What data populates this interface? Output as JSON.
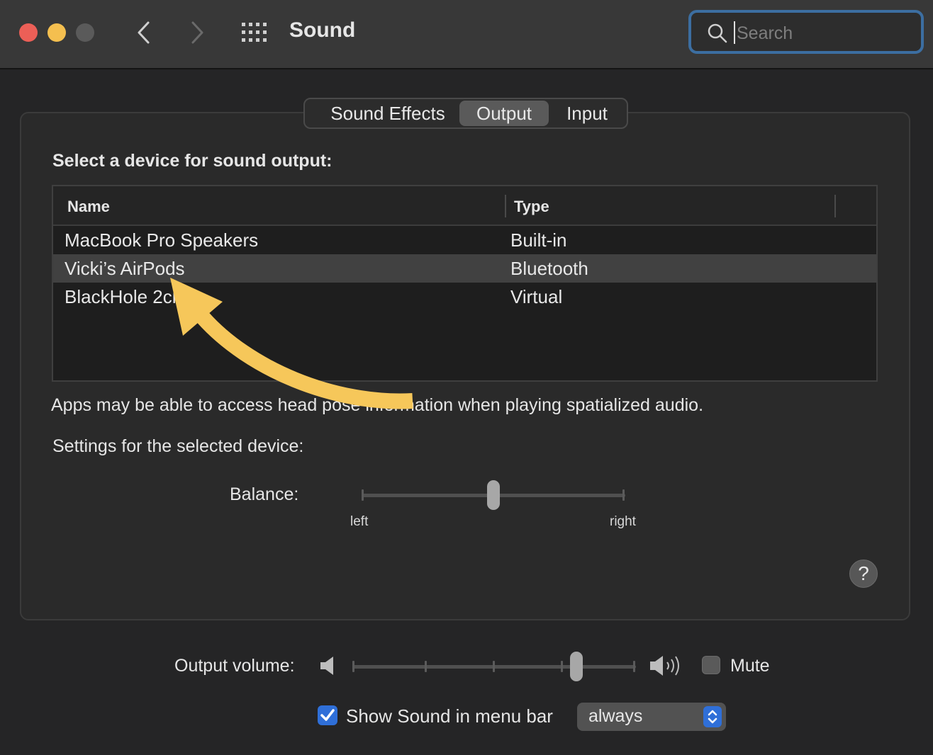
{
  "window": {
    "title": "Sound",
    "search": {
      "placeholder": "Search",
      "value": ""
    }
  },
  "tabs": [
    {
      "label": "Sound Effects",
      "selected": false
    },
    {
      "label": "Output",
      "selected": true
    },
    {
      "label": "Input",
      "selected": false
    }
  ],
  "output": {
    "heading": "Select a device for sound output:",
    "columns": [
      "Name",
      "Type"
    ],
    "devices": [
      {
        "name": "MacBook Pro Speakers",
        "type": "Built-in",
        "selected": false
      },
      {
        "name": "Vicki’s AirPods",
        "type": "Bluetooth",
        "selected": true
      },
      {
        "name": "BlackHole 2ch",
        "type": "Virtual",
        "selected": false
      }
    ],
    "spatial_note": "Apps may be able to access head pose information when playing spatialized audio.",
    "device_settings_label": "Settings for the selected device:",
    "balance": {
      "label": "Balance:",
      "left_label": "left",
      "right_label": "right",
      "value": 0.5
    },
    "help_label": "?"
  },
  "footer": {
    "volume_label": "Output volume:",
    "volume_value": 0.79,
    "mute_label": "Mute",
    "mute_checked": false,
    "show_in_menubar_label": "Show Sound in menu bar",
    "show_in_menubar_checked": true,
    "menubar_option": "always"
  },
  "colors": {
    "accent": "#2f6fd8",
    "annotation_arrow": "#f6c75a",
    "search_focus": "#3c6ea1"
  }
}
